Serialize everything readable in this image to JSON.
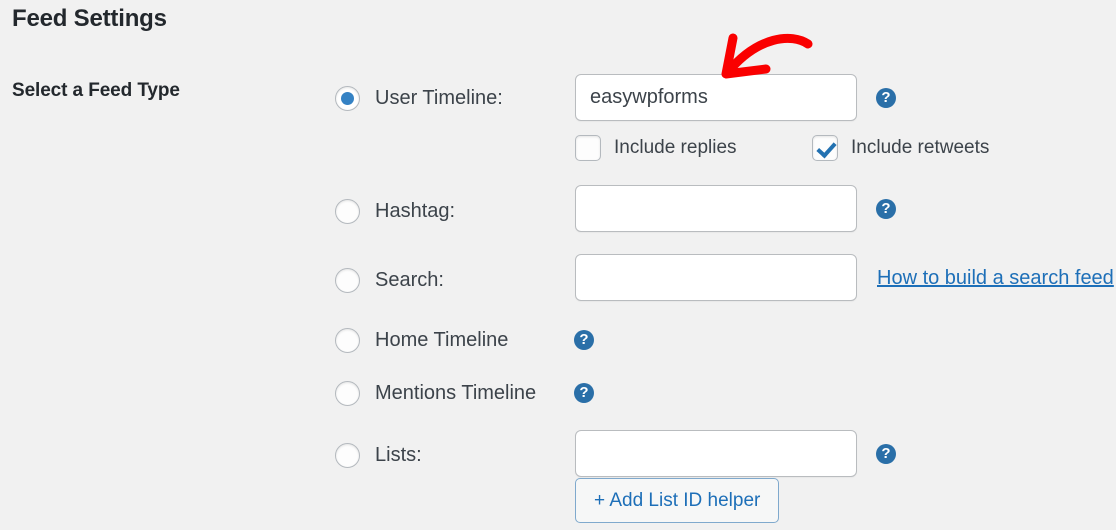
{
  "page": {
    "title": "Feed Settings",
    "section_label": "Select a Feed Type"
  },
  "feed_types": [
    {
      "id": "user-timeline",
      "label": "User Timeline:",
      "selected": true,
      "has_input": true,
      "input_value": "easywpforms",
      "input_placeholder": "",
      "help_icon": "question-mark-icon"
    },
    {
      "id": "hashtag",
      "label": "Hashtag:",
      "selected": false,
      "has_input": true,
      "input_value": "",
      "input_placeholder": "",
      "help_icon": "question-mark-icon"
    },
    {
      "id": "search",
      "label": "Search:",
      "selected": false,
      "has_input": true,
      "input_value": "",
      "input_placeholder": "",
      "link_text": "How to build a search feed"
    },
    {
      "id": "home-timeline",
      "label": "Home Timeline",
      "selected": false,
      "has_input": false,
      "help_icon": "question-mark-icon"
    },
    {
      "id": "mentions-timeline",
      "label": "Mentions Timeline",
      "selected": false,
      "has_input": false,
      "help_icon": "question-mark-icon"
    },
    {
      "id": "lists",
      "label": "Lists:",
      "selected": false,
      "has_input": true,
      "input_value": "",
      "input_placeholder": "",
      "help_icon": "question-mark-icon",
      "button_label": "+ Add List ID helper"
    }
  ],
  "user_timeline_options": [
    {
      "id": "include-replies",
      "label": "Include replies",
      "checked": false
    },
    {
      "id": "include-retweets",
      "label": "Include retweets",
      "checked": true
    }
  ],
  "icons": {
    "help": "?",
    "annotation": "red-curved-arrow"
  },
  "colors": {
    "background": "#f1f1f1",
    "accent_blue": "#2271b1",
    "link_blue": "#1d6fb8",
    "help_icon_blue": "#2a6fa8",
    "annotation_red": "#fa0000",
    "text": "#3c434a",
    "heading": "#23282d"
  }
}
